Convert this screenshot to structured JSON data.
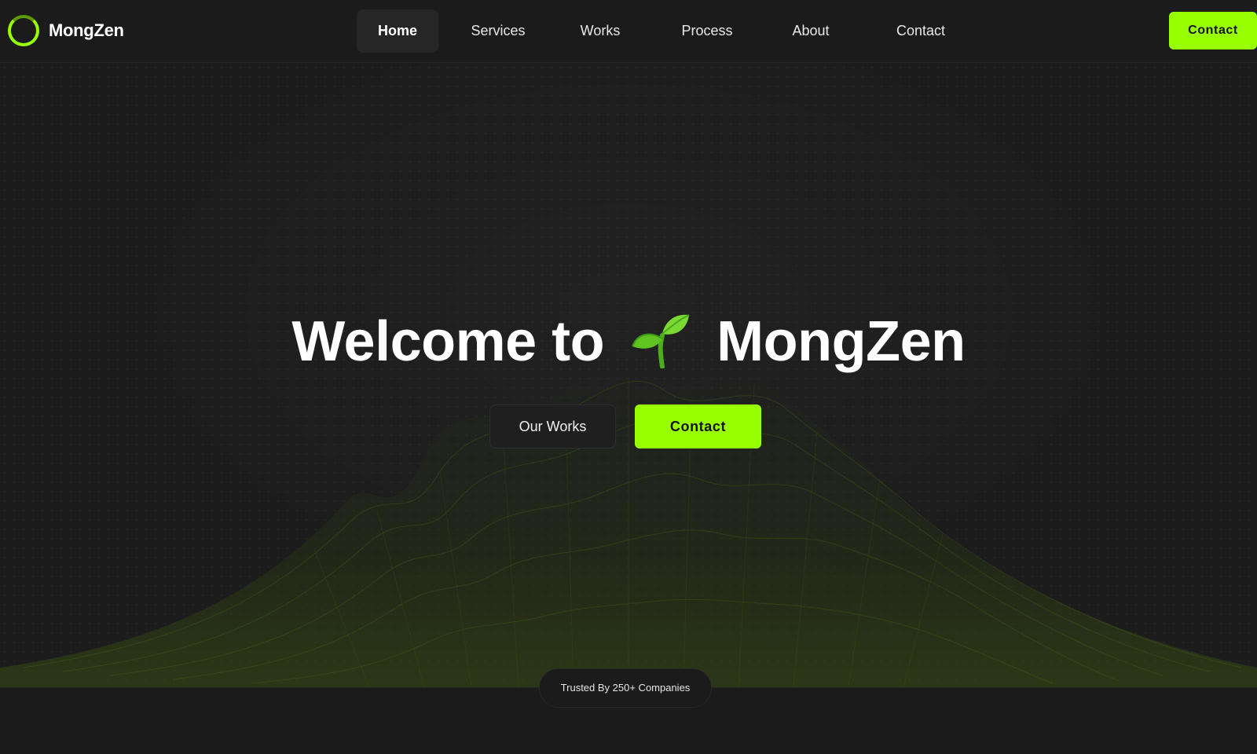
{
  "brand": {
    "name": "MongZen",
    "accent_color": "#98ff00",
    "logo_icon": "ring-logo-icon"
  },
  "nav": {
    "items": [
      {
        "label": "Home",
        "active": true
      },
      {
        "label": "Services",
        "active": false
      },
      {
        "label": "Works",
        "active": false
      },
      {
        "label": "Process",
        "active": false
      },
      {
        "label": "About",
        "active": false
      },
      {
        "label": "Contact",
        "active": false
      }
    ],
    "cta_label": "Contact"
  },
  "hero": {
    "title_before": "Welcome to",
    "title_after": "MongZen",
    "emoji_icon": "seedling-icon",
    "secondary_button": "Our Works",
    "primary_button": "Contact",
    "background": "dot-grid-with-wireframe-mountain"
  },
  "trusted": {
    "label": "Trusted By 250+ Companies"
  },
  "colors": {
    "background": "#1a1a1a",
    "accent": "#98ff00",
    "text": "#ffffff"
  }
}
